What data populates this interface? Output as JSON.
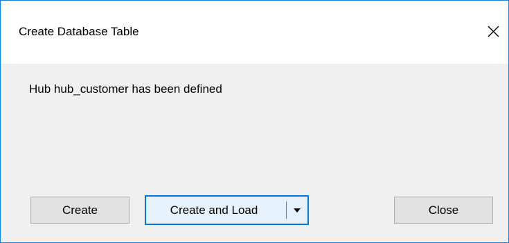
{
  "window": {
    "title": "Create Database Table",
    "close_icon": "close-icon"
  },
  "message": "Hub hub_customer has been defined",
  "buttons": {
    "create": "Create",
    "create_and_load": "Create and Load",
    "close": "Close"
  },
  "colors": {
    "accent": "#0078d7",
    "window_border": "#1883d7",
    "dialog_bg": "#f0f0f0",
    "button_bg": "#e1e1e1",
    "focused_button_bg": "#e5f1fb"
  }
}
